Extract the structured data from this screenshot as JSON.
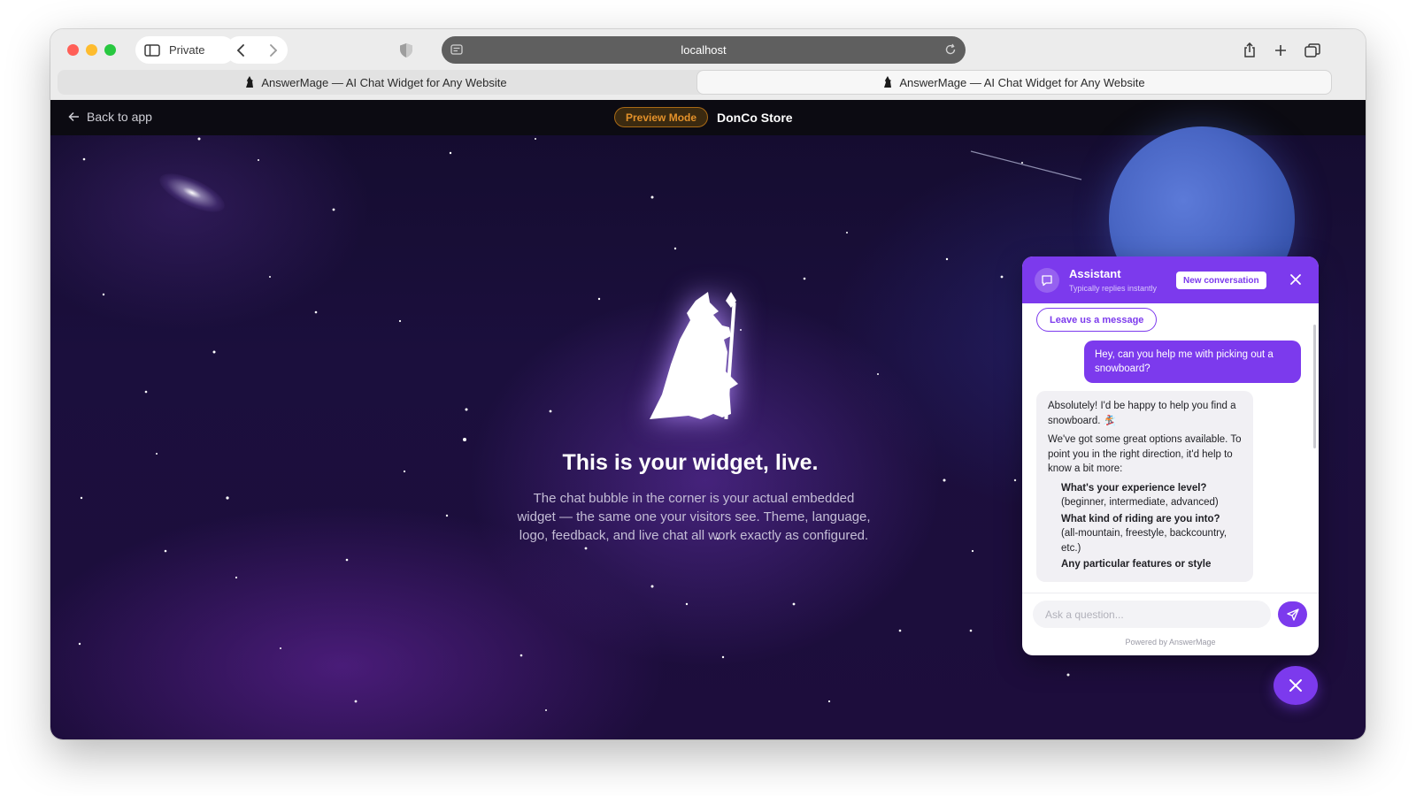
{
  "browser": {
    "private_label": "Private",
    "url": "localhost",
    "tabs": [
      {
        "title": "AnswerMage — AI Chat Widget for Any Website",
        "active": false
      },
      {
        "title": "AnswerMage — AI Chat Widget for Any Website",
        "active": true
      }
    ]
  },
  "page_nav": {
    "back_label": "Back to app",
    "preview_badge": "Preview Mode",
    "store_name": "DonCo Store"
  },
  "hero": {
    "title": "This is your widget, live.",
    "description": "The chat bubble in the corner is your actual embedded widget — the same one your visitors see. Theme, language, logo, feedback, and live chat all work exactly as configured."
  },
  "chat": {
    "assistant_name": "Assistant",
    "status": "Typically replies instantly",
    "new_conversation_label": "New conversation",
    "leave_message_label": "Leave us a message",
    "user_message": "Hey, can you help me with picking out a snowboard?",
    "bot_message": {
      "intro": "Absolutely! I'd be happy to help you find a snowboard. 🏂",
      "body": "We've got some great options available. To point you in the right direction, it'd help to know a bit more:",
      "questions": [
        {
          "title": "What's your experience level?",
          "detail": "(beginner, intermediate, advanced)"
        },
        {
          "title": "What kind of riding are you into?",
          "detail": "(all-mountain, freestyle, backcountry, etc.)"
        },
        {
          "title": "Any particular features or style",
          "detail": ""
        }
      ]
    },
    "input_placeholder": "Ask a question...",
    "powered_by": "Powered by AnswerMage"
  },
  "colors": {
    "accent": "#7c3aed",
    "preview_badge": "#e3912a",
    "planet": "#4966c4"
  },
  "icons": {
    "sidebar": "sidebar-icon",
    "back": "chevron-left-icon",
    "forward": "chevron-right-icon",
    "share": "share-icon",
    "new_tab": "plus-icon",
    "tabs_overview": "tabs-icon",
    "chat_avatar": "chat-bubble-icon",
    "send": "send-icon",
    "close": "close-icon"
  }
}
